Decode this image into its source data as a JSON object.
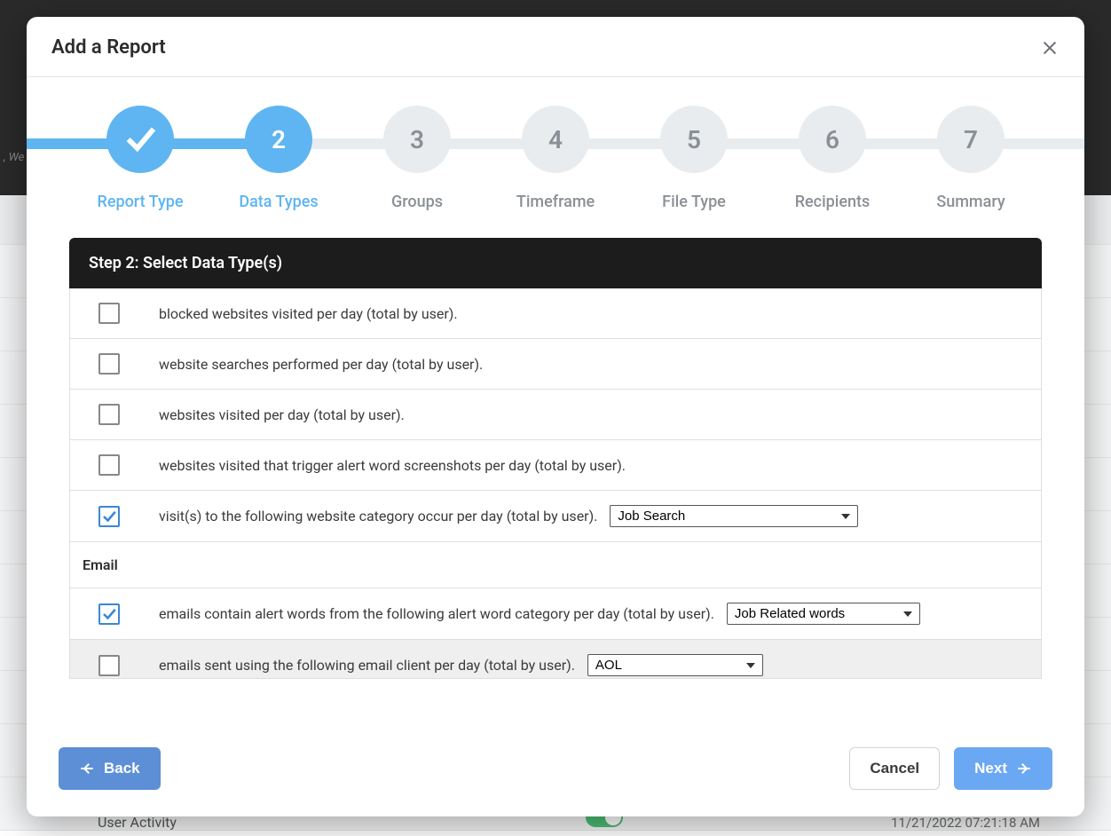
{
  "modal": {
    "title": "Add a Report",
    "panel_title": "Step 2: Select Data Type(s)"
  },
  "steps": [
    {
      "label": "Report Type",
      "state": "done",
      "num": "1"
    },
    {
      "label": "Data Types",
      "state": "active",
      "num": "2"
    },
    {
      "label": "Groups",
      "state": "pending",
      "num": "3"
    },
    {
      "label": "Timeframe",
      "state": "pending",
      "num": "4"
    },
    {
      "label": "File Type",
      "state": "pending",
      "num": "5"
    },
    {
      "label": "Recipients",
      "state": "pending",
      "num": "6"
    },
    {
      "label": "Summary",
      "state": "pending",
      "num": "7"
    }
  ],
  "buttons": {
    "back": "Back",
    "cancel": "Cancel",
    "next": "Next"
  },
  "items": {
    "blocked_websites": "blocked websites visited per day (total by user).",
    "website_searches": "website searches performed per day (total by user).",
    "websites_visited": "websites visited per day (total by user).",
    "websites_alert": "websites visited that trigger alert word screenshots per day (total by user).",
    "visits_category": "visit(s) to the following website category occur per day (total by user).",
    "emails_alert": "emails contain alert words from the following alert word category per day (total by user).",
    "emails_client": "emails sent using the following email client per day (total by user)."
  },
  "sections": {
    "email": "Email"
  },
  "selects": {
    "visits_category": "Job Search",
    "emails_alert": "Job Related words",
    "emails_client": "AOL"
  },
  "background": {
    "hint": ", We",
    "row_label": "User Activity",
    "date": "11/21/2022 07:21:18 AM"
  }
}
